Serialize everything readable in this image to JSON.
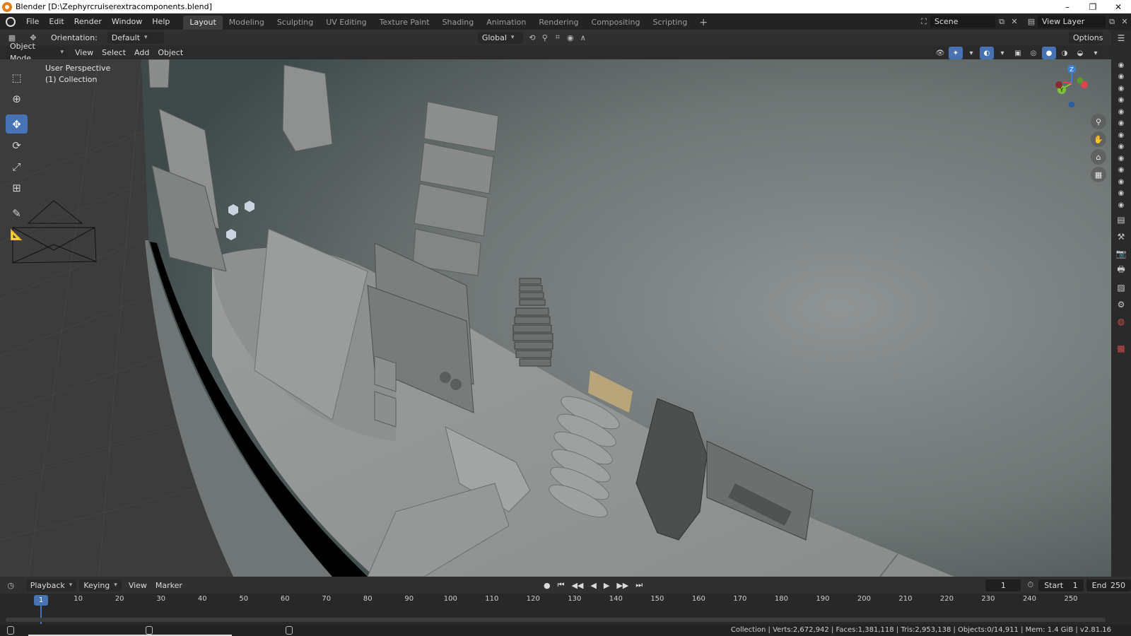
{
  "window": {
    "title": "Blender [D:\\Zephyrcruiserextracomponents.blend]",
    "controls": [
      "–",
      "❐",
      "✕"
    ]
  },
  "topbar": {
    "menus": [
      "File",
      "Edit",
      "Render",
      "Window",
      "Help"
    ],
    "workspaces": [
      "Layout",
      "Modeling",
      "Sculpting",
      "UV Editing",
      "Texture Paint",
      "Shading",
      "Animation",
      "Rendering",
      "Compositing",
      "Scripting"
    ],
    "active_workspace": "Layout",
    "add_workspace": "+",
    "scene": "Scene",
    "view_layer": "View Layer"
  },
  "header": {
    "orientation_label": "Orientation:",
    "orientation_value": "Default",
    "transform_orientation": "Global",
    "options_label": "Options",
    "mode": "Object Mode",
    "menus": [
      "View",
      "Select",
      "Add",
      "Object"
    ]
  },
  "viewport": {
    "perspective_label": "User Perspective",
    "collection_label": "(1) Collection",
    "gizmo_axes": {
      "z": "Z",
      "y": "Y",
      "x": "X"
    },
    "axis_colors": {
      "x": "#e4414e",
      "y": "#7ec335",
      "z": "#3d7fd8"
    }
  },
  "timeline": {
    "menus": [
      "Playback",
      "Keying",
      "View",
      "Marker"
    ],
    "current_frame": "1",
    "start_label": "Start",
    "start_value": "1",
    "end_label": "End",
    "end_value": "250",
    "ticks": [
      "10",
      "20",
      "30",
      "40",
      "50",
      "60",
      "70",
      "80",
      "90",
      "100",
      "110",
      "120",
      "130",
      "140",
      "150",
      "160",
      "170",
      "180",
      "190",
      "200",
      "210",
      "220",
      "230",
      "240",
      "250"
    ]
  },
  "statusbar": {
    "stats": "Collection | Verts:2,672,942 | Faces:1,381,118 | Tris:2,953,138 | Objects:0/14,911 | Mem: 1.4 GiB | v2.81.16"
  },
  "colors": {
    "accent": "#4772b3",
    "brand": "#e87d0d"
  }
}
